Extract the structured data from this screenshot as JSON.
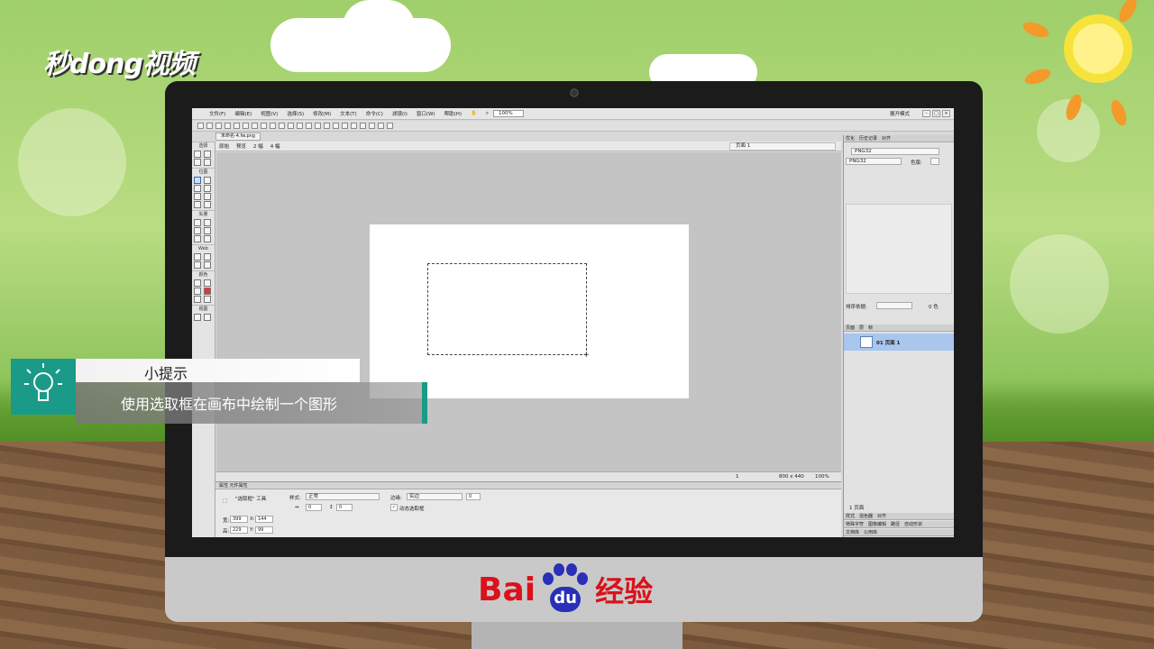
{
  "branding": {
    "watermark": "秒dong视频",
    "footer_brand_bai": "Bai",
    "footer_brand_du": "du",
    "footer_brand_jy": "经验"
  },
  "app": {
    "menu": [
      "文件(F)",
      "编辑(E)",
      "视图(V)",
      "选择(S)",
      "修改(M)",
      "文本(T)",
      "命令(C)",
      "滤镜(I)",
      "窗口(W)",
      "帮助(H)"
    ],
    "zoom_select": "100%",
    "workspace_mode": "展开模式",
    "document_tab": "未命名-4.fw.png",
    "view_tabs": [
      "原始",
      "预览",
      "2 幅",
      "4 幅"
    ],
    "page_selector": "页面 1",
    "tool_sections": [
      "选择",
      "位图",
      "矢量",
      "Web",
      "颜色",
      "视图"
    ],
    "status": {
      "frame": "1",
      "canvas_size": "800 x 440",
      "zoom": "100%"
    }
  },
  "properties": {
    "tabs": "属性  元件属性",
    "tool_name": "\"选取框\" 工具",
    "style_label": "样式:",
    "style_value": "正常",
    "edge_label": "边缘:",
    "edge_value": "实边",
    "edge_amount": "0",
    "dynamic_marquee": "动态选取框",
    "width_label": "宽:",
    "width_value": "399",
    "height_label": "高:",
    "height_value": "229",
    "x_label": "X:",
    "x_value": "144",
    "y_label": "Y:",
    "y_value": "99",
    "ratio_w": "0",
    "ratio_h": "0"
  },
  "right_panel": {
    "top_tabs": [
      "优化",
      "历史记录",
      "对齐"
    ],
    "settings_select": "PNG32",
    "format_select": "PNG32",
    "matte_label": "色版:",
    "sort_label": "排序依据:",
    "colors_count": "0 色",
    "layer_tabs": [
      "页面",
      "层",
      "帧"
    ],
    "page_item": "01 页面 1",
    "page_count": "1 页面",
    "bottom_tabs_1": [
      "样式",
      "混色器",
      "对齐"
    ],
    "bottom_tabs_2": [
      "特殊字符",
      "图像编辑",
      "路径",
      "自动形状"
    ],
    "bottom_tabs_3": [
      "文档库",
      "公用库"
    ]
  },
  "tip": {
    "title": "小提示",
    "text": "使用选取框在画布中绘制一个图形"
  },
  "colors": {
    "accent": "#1a9a88",
    "brand_red": "#d9121b",
    "brand_blue": "#2a2fb8",
    "layer_highlight": "#a9c6ec"
  }
}
